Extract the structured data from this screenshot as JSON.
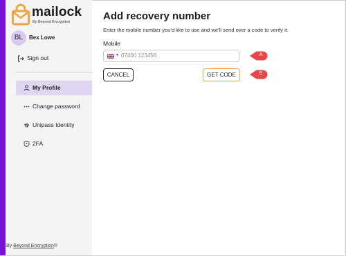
{
  "brand": {
    "name": "mailock",
    "tagline": "By Beyond Encryption",
    "accent_color": "#7a12d4",
    "logo_color": "#f0a63a"
  },
  "user": {
    "initials": "BL",
    "name": "Bex Lowe"
  },
  "sidebar": {
    "signout_label": "Sign out",
    "items": [
      {
        "label": "My Profile",
        "icon": "user-icon",
        "active": true
      },
      {
        "label": "Change password",
        "icon": "password-dots-icon",
        "active": false
      },
      {
        "label": "Unipass Identity",
        "icon": "gear-icon",
        "active": false
      },
      {
        "label": "2FA",
        "icon": "shield-icon",
        "active": false
      }
    ]
  },
  "main": {
    "title": "Add recovery number",
    "subtitle": "Enter the mobile number you'd like to use and we'll send over a code to verify it.",
    "mobile_label": "Mobile",
    "phone": {
      "country_flag": "gb-flag-icon",
      "placeholder": "07400 123456",
      "value": ""
    },
    "cancel_label": "CANCEL",
    "get_code_label": "GET CODE"
  },
  "callouts": {
    "a": "A",
    "b": "B",
    "color": "#e5474b"
  },
  "footer": {
    "prefix": "By ",
    "link": "Beyond Encryption",
    "suffix": "®"
  }
}
